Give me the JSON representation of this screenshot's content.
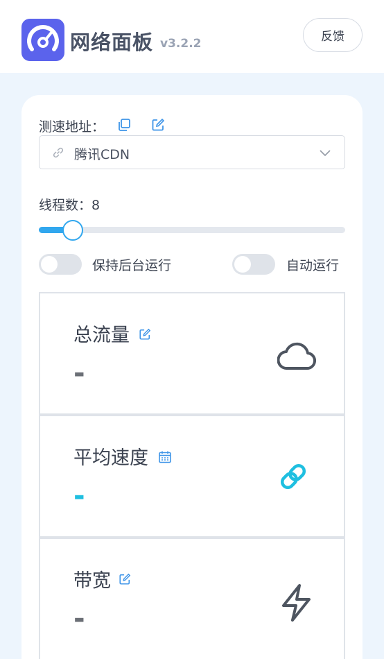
{
  "header": {
    "title": "网络面板",
    "version": "v3.2.2",
    "feedback_label": "反馈"
  },
  "settings": {
    "speed_url_label": "测速地址：",
    "speed_url_value": "腾讯CDN",
    "threads_label": "线程数：8",
    "threads_value": 8,
    "background_label": "保持后台运行",
    "background_on": false,
    "autorun_label": "自动运行",
    "autorun_on": false
  },
  "stats": [
    {
      "title": "总流量",
      "value": "-",
      "value_color": "#6b6f76",
      "icon": "cloud-icon",
      "title_icon": "edit-icon"
    },
    {
      "title": "平均速度",
      "value": "-",
      "value_color": "#1fbfe0",
      "icon": "link-icon",
      "title_icon": "calendar-icon"
    },
    {
      "title": "带宽",
      "value": "-",
      "value_color": "#6b6f76",
      "icon": "lightning-icon",
      "title_icon": "edit-icon"
    }
  ],
  "colors": {
    "accent": "#31a7ee",
    "brand": "#5b63ec",
    "cyan": "#1fbfe0"
  }
}
